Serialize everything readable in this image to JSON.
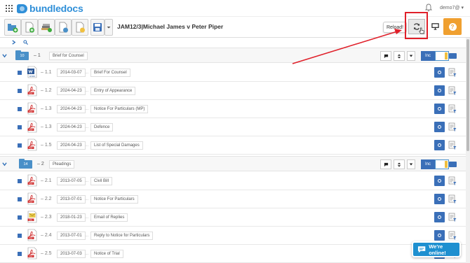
{
  "app": {
    "logo_text": "bundledocs",
    "user_menu": "demo7@ ▾"
  },
  "case": {
    "title": "JAM12/3|Michael James v Peter Piper"
  },
  "toolbar": {
    "reload_tooltip": "Reload!",
    "help_label": "?"
  },
  "colors": {
    "brand": "#2f8fd8",
    "row_button": "#3a6fb8",
    "help": "#f0a030",
    "highlight": "#e0202a"
  },
  "sections": [
    {
      "folder_count": "10",
      "number": "– 1",
      "title": "Brief for Counsel",
      "inc_label": "Inc",
      "rows": [
        {
          "type": "word",
          "type_label": "WORD",
          "number": "– 1.1",
          "date": "2014-03-07",
          "dots": "...",
          "title": "Brief For Counsel"
        },
        {
          "type": "pdf",
          "type_label": "PDF",
          "number": "– 1.2",
          "date": "2024-04-23",
          "dots": "...",
          "title": "Entry of Appearance"
        },
        {
          "type": "pdf",
          "type_label": "PDF",
          "number": "– 1.3",
          "date": "2024-04-23",
          "dots": "...",
          "title": "Notice For Particulars (MP)"
        },
        {
          "type": "pdf",
          "type_label": "PDF",
          "number": "– 1.3",
          "date": "2024-04-23",
          "dots": "...",
          "title": "Defence"
        },
        {
          "type": "pdf",
          "type_label": "PDF",
          "number": "– 1.5",
          "date": "2024-04-23",
          "dots": "...",
          "title": "List of Special Damages"
        }
      ]
    },
    {
      "folder_count": "14",
      "number": "– 2",
      "title": "Pleadings",
      "inc_label": "Inc",
      "rows": [
        {
          "type": "pdf",
          "type_label": "PDF",
          "number": "– 2.1",
          "date": "2013-07-05",
          "dots": "...",
          "title": "Civil Bill"
        },
        {
          "type": "pdf",
          "type_label": "PDF",
          "number": "– 2.2",
          "date": "2013-07-01",
          "dots": "...",
          "title": "Notice For Particulars"
        },
        {
          "type": "email",
          "type_label": "EML",
          "number": "– 2.3",
          "date": "2018-01-23",
          "dots": "...",
          "title": "Email of Replies"
        },
        {
          "type": "pdf",
          "type_label": "PDF",
          "number": "– 2.4",
          "date": "2013-07-01",
          "dots": "...",
          "title": "Reply to Notice for Particulars"
        },
        {
          "type": "pdf",
          "type_label": "PDF",
          "number": "– 2.5",
          "date": "2013-07-03",
          "dots": "...",
          "title": "Notice of Trial"
        }
      ]
    }
  ],
  "chat": {
    "label": "We're online!"
  }
}
